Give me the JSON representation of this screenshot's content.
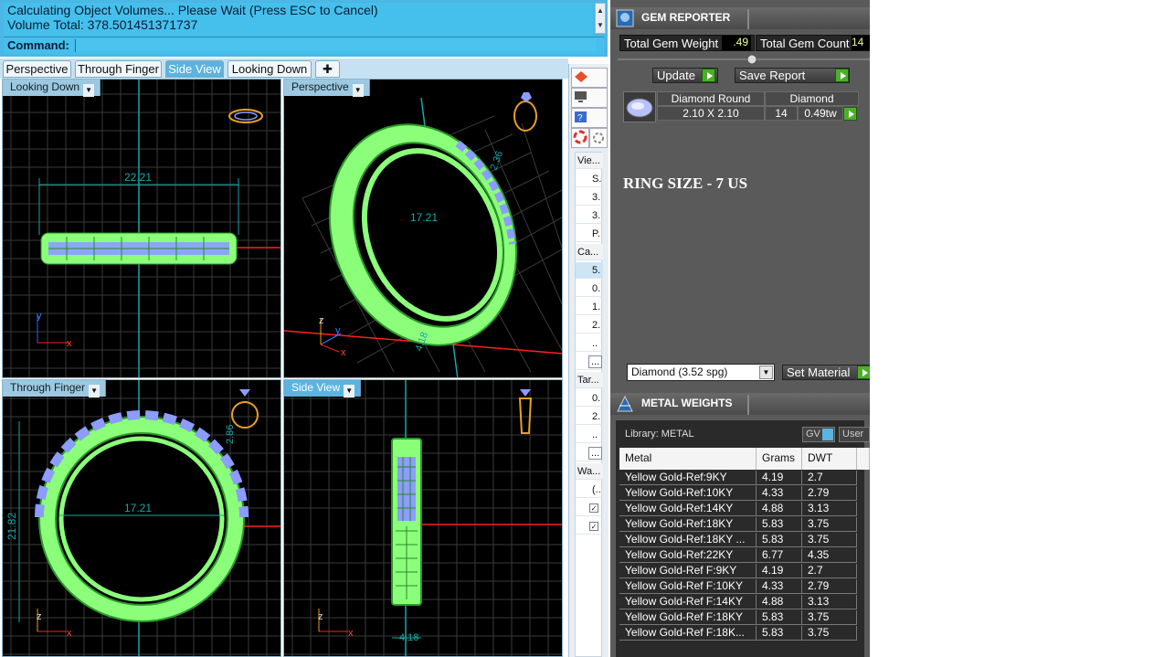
{
  "command_area": {
    "history": [
      "Calculating Object Volumes... Please Wait (Press ESC to Cancel)",
      "Volume Total: 378.501451371737"
    ],
    "command_label": "Command:"
  },
  "view_tabs": [
    {
      "label": "Perspective",
      "active": false
    },
    {
      "label": "Through Finger",
      "active": false
    },
    {
      "label": "Side View",
      "active": true
    },
    {
      "label": "Looking Down",
      "active": false
    }
  ],
  "viewports": {
    "top_left": {
      "label": "Looking Down",
      "dimension": "22.21",
      "axis_labels": [
        "y",
        "x"
      ]
    },
    "top_right": {
      "label": "Perspective",
      "dimensions": [
        "17.21",
        "4.18",
        "2.36"
      ],
      "axis_labels": [
        "z",
        "y",
        "x"
      ]
    },
    "bottom_left": {
      "label": "Through Finger",
      "dimensions": [
        "17.21",
        "21.82",
        "2.86"
      ],
      "axis_labels": [
        "z",
        "x"
      ]
    },
    "bottom_right": {
      "label": "Side View",
      "dimension": "4.18",
      "axis_labels": [
        "z",
        "x"
      ]
    }
  },
  "side_panel": {
    "rows": [
      {
        "text": "Vie...",
        "type": "hdr"
      },
      {
        "text": "S.",
        "type": "item"
      },
      {
        "text": "3.",
        "type": "item"
      },
      {
        "text": "3.",
        "type": "item"
      },
      {
        "text": "P.",
        "type": "item"
      },
      {
        "text": "Ca...",
        "type": "hdr"
      },
      {
        "text": "5.",
        "type": "sel"
      },
      {
        "text": "0.",
        "type": "item"
      },
      {
        "text": "1.",
        "type": "item"
      },
      {
        "text": "2.",
        "type": "item"
      },
      {
        "text": "..",
        "type": "item"
      },
      {
        "text": "...",
        "type": "btn"
      },
      {
        "text": "Tar...",
        "type": "hdr"
      },
      {
        "text": "0.",
        "type": "item"
      },
      {
        "text": "2.",
        "type": "item"
      },
      {
        "text": "..",
        "type": "item"
      },
      {
        "text": "...",
        "type": "btn"
      },
      {
        "text": "Wa...",
        "type": "hdr"
      },
      {
        "text": "(..",
        "type": "item"
      },
      {
        "text": "✓",
        "type": "chk"
      },
      {
        "text": "✓",
        "type": "chk"
      }
    ]
  },
  "gem_reporter": {
    "title": "GEM REPORTER",
    "total_gem_weight_label": "Total Gem Weight",
    "total_gem_weight": ".49",
    "total_gem_count_label": "Total Gem Count",
    "total_gem_count": "14",
    "update_label": "Update",
    "save_report_label": "Save Report",
    "gem_row": {
      "shape": "Diamond Round",
      "material": "Diamond",
      "size": "2.10 X 2.10",
      "count": "14",
      "weight": "0.49tw"
    },
    "note": "RING SIZE - 7  US",
    "material_select": "Diamond      (3.52 spg)",
    "set_material_label": "Set Material"
  },
  "metal_weights": {
    "title": "METAL WEIGHTS",
    "library_label": "Library: METAL",
    "gv_label": "GV",
    "user_label": "User",
    "columns": [
      "Metal",
      "Grams",
      "DWT"
    ],
    "rows": [
      {
        "metal": "Yellow Gold-Ref:9KY",
        "grams": "4.19",
        "dwt": "2.7"
      },
      {
        "metal": "Yellow Gold-Ref:10KY",
        "grams": "4.33",
        "dwt": "2.79"
      },
      {
        "metal": "Yellow Gold-Ref:14KY",
        "grams": "4.88",
        "dwt": "3.13"
      },
      {
        "metal": "Yellow Gold-Ref:18KY",
        "grams": "5.83",
        "dwt": "3.75"
      },
      {
        "metal": "Yellow Gold-Ref:18KY ...",
        "grams": "5.83",
        "dwt": "3.75"
      },
      {
        "metal": "Yellow Gold-Ref:22KY",
        "grams": "6.77",
        "dwt": "4.35"
      },
      {
        "metal": "Yellow Gold-Ref F:9KY",
        "grams": "4.19",
        "dwt": "2.7"
      },
      {
        "metal": "Yellow Gold-Ref F:10KY",
        "grams": "4.33",
        "dwt": "2.79"
      },
      {
        "metal": "Yellow Gold-Ref F:14KY",
        "grams": "4.88",
        "dwt": "3.13"
      },
      {
        "metal": "Yellow Gold-Ref F:18KY",
        "grams": "5.83",
        "dwt": "3.75"
      },
      {
        "metal": "Yellow Gold-Ref F:18K...",
        "grams": "5.83",
        "dwt": "3.75"
      }
    ]
  },
  "colors": {
    "wire": "#8cff7a",
    "gem": "#8c9cff",
    "grid": "#3a3a3a",
    "axis_red": "#ff2020",
    "axis_teal": "#1aa6a6",
    "panel_blue": "#4cb6e4"
  }
}
